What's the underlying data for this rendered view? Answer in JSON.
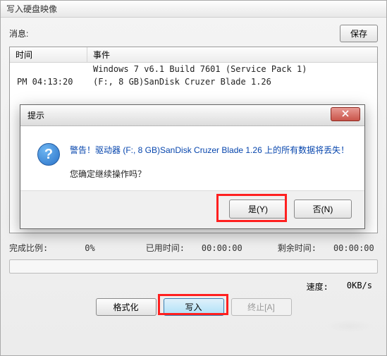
{
  "window": {
    "title": "写入硬盘映像"
  },
  "info": {
    "label": "消息:",
    "save_btn": "保存"
  },
  "list": {
    "header_time": "时间",
    "header_event": "事件",
    "rows": [
      {
        "time": "",
        "event": "Windows 7 v6.1 Build 7601 (Service Pack 1)"
      },
      {
        "time": "PM 04:13:20",
        "event": "(F:, 8 GB)SanDisk Cruzer Blade    1.26"
      }
    ]
  },
  "progress": {
    "done_label": "完成比例:",
    "done_value": "0%",
    "elapsed_label": "已用时间:",
    "elapsed_value": "00:00:00",
    "remain_label": "剩余时间:",
    "remain_value": "00:00:00"
  },
  "speed": {
    "label": "速度:",
    "value": "0KB/s"
  },
  "buttons": {
    "format": "格式化",
    "write": "写入",
    "abort": "终止[A]"
  },
  "dialog": {
    "title": "提示",
    "warn_line": "警告！驱动器 (F:, 8 GB)SanDisk Cruzer Blade    1.26 上的所有数据将丢失！",
    "confirm_line": "您确定继续操作吗？",
    "yes": "是(Y)",
    "no": "否(N)"
  }
}
